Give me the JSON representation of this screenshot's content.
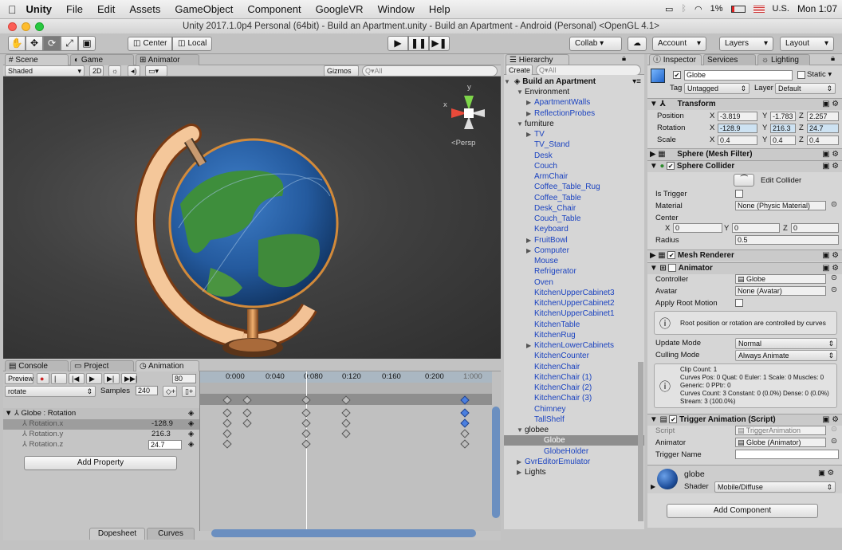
{
  "mac_menu": {
    "apple": "",
    "app": "Unity",
    "items": [
      "File",
      "Edit",
      "Assets",
      "GameObject",
      "Component",
      "GoogleVR",
      "Window",
      "Help"
    ],
    "battery": "1%",
    "region": "U.S.",
    "clock": "Mon 1:07"
  },
  "window_title": "Unity 2017.1.0p4 Personal (64bit) - Build an Apartment.unity - Build an Apartment - Android (Personal) <OpenGL 4.1>",
  "toolbar": {
    "center": "Center",
    "local": "Local",
    "collab": "Collab ▾",
    "account": "Account",
    "layers": "Layers",
    "layout": "Layout"
  },
  "scene_tabs": {
    "scene": "Scene",
    "game": "Game",
    "animator": "Animator"
  },
  "scene_bar": {
    "shaded": "Shaded",
    "two_d": "2D",
    "gizmos": "Gizmos",
    "search": "Q▾All"
  },
  "scene_view": {
    "persp": "Persp",
    "axes": {
      "y": "y",
      "x": "x"
    }
  },
  "hierarchy": {
    "tab": "Hierarchy",
    "create": "Create",
    "search": "Q▾All",
    "scene": "Build an Apartment",
    "rows": [
      {
        "t": "Environment",
        "i": 1,
        "a": "▼",
        "c": "n"
      },
      {
        "t": "ApartmentWalls",
        "i": 2,
        "a": "▶",
        "c": "b"
      },
      {
        "t": "ReflectionProbes",
        "i": 2,
        "a": "▶",
        "c": "b"
      },
      {
        "t": "furniture",
        "i": 1,
        "a": "▼",
        "c": "n"
      },
      {
        "t": "TV",
        "i": 2,
        "a": "▶",
        "c": "b"
      },
      {
        "t": "TV_Stand",
        "i": 2,
        "a": "",
        "c": "b"
      },
      {
        "t": "Desk",
        "i": 2,
        "a": "",
        "c": "b"
      },
      {
        "t": "Couch",
        "i": 2,
        "a": "",
        "c": "b"
      },
      {
        "t": "ArmChair",
        "i": 2,
        "a": "",
        "c": "b"
      },
      {
        "t": "Coffee_Table_Rug",
        "i": 2,
        "a": "",
        "c": "b"
      },
      {
        "t": "Coffee_Table",
        "i": 2,
        "a": "",
        "c": "b"
      },
      {
        "t": "Desk_Chair",
        "i": 2,
        "a": "",
        "c": "b"
      },
      {
        "t": "Couch_Table",
        "i": 2,
        "a": "",
        "c": "b"
      },
      {
        "t": "Keyboard",
        "i": 2,
        "a": "",
        "c": "b"
      },
      {
        "t": "FruitBowl",
        "i": 2,
        "a": "▶",
        "c": "b"
      },
      {
        "t": "Computer",
        "i": 2,
        "a": "▶",
        "c": "b"
      },
      {
        "t": "Mouse",
        "i": 2,
        "a": "",
        "c": "b"
      },
      {
        "t": "Refrigerator",
        "i": 2,
        "a": "",
        "c": "b"
      },
      {
        "t": "Oven",
        "i": 2,
        "a": "",
        "c": "b"
      },
      {
        "t": "KitchenUpperCabinet3",
        "i": 2,
        "a": "",
        "c": "b"
      },
      {
        "t": "KitchenUpperCabinet2",
        "i": 2,
        "a": "",
        "c": "b"
      },
      {
        "t": "KitchenUpperCabinet1",
        "i": 2,
        "a": "",
        "c": "b"
      },
      {
        "t": "KitchenTable",
        "i": 2,
        "a": "",
        "c": "b"
      },
      {
        "t": "KitchenRug",
        "i": 2,
        "a": "",
        "c": "b"
      },
      {
        "t": "KitchenLowerCabinets",
        "i": 2,
        "a": "▶",
        "c": "b"
      },
      {
        "t": "KitchenCounter",
        "i": 2,
        "a": "",
        "c": "b"
      },
      {
        "t": "KitchenChair",
        "i": 2,
        "a": "",
        "c": "b"
      },
      {
        "t": "KitchenChair (1)",
        "i": 2,
        "a": "",
        "c": "b"
      },
      {
        "t": "KitchenChair (2)",
        "i": 2,
        "a": "",
        "c": "b"
      },
      {
        "t": "KitchenChair (3)",
        "i": 2,
        "a": "",
        "c": "b"
      },
      {
        "t": "Chimney",
        "i": 2,
        "a": "",
        "c": "b"
      },
      {
        "t": "TallShelf",
        "i": 2,
        "a": "",
        "c": "b"
      },
      {
        "t": "globee",
        "i": 1,
        "a": "▼",
        "c": "n"
      },
      {
        "t": "Globe",
        "i": 3,
        "a": "",
        "c": "s"
      },
      {
        "t": "GlobeHolder",
        "i": 3,
        "a": "",
        "c": "b"
      },
      {
        "t": "GvrEditorEmulator",
        "i": 1,
        "a": "▶",
        "c": "b"
      },
      {
        "t": "Lights",
        "i": 1,
        "a": "▶",
        "c": "n"
      }
    ]
  },
  "inspector": {
    "tabs": {
      "inspector": "Inspector",
      "services": "Services",
      "lighting": "Lighting"
    },
    "name": "Globe",
    "static": "Static",
    "tag_label": "Tag",
    "tag": "Untagged",
    "layer_label": "Layer",
    "layer": "Default",
    "transform": {
      "title": "Transform",
      "position_label": "Position",
      "rotation_label": "Rotation",
      "scale_label": "Scale",
      "px": "-3.819",
      "py": "-1.783",
      "pz": "2.257",
      "rx": "-128.9",
      "ry": "216.3",
      "rz": "24.7",
      "sx": "0.4",
      "sy": "0.4",
      "sz": "0.4",
      "x": "X",
      "y": "Y",
      "z": "Z"
    },
    "mesh_filter": "Sphere (Mesh Filter)",
    "collider": {
      "title": "Sphere Collider",
      "edit": "Edit Collider",
      "is_trigger": "Is Trigger",
      "material_label": "Material",
      "material": "None (Physic Material)",
      "center_label": "Center",
      "cx": "0",
      "cy": "0",
      "cz": "0",
      "radius_label": "Radius",
      "radius": "0.5"
    },
    "mesh_renderer": "Mesh Renderer",
    "animator": {
      "title": "Animator",
      "controller_label": "Controller",
      "controller": "Globe",
      "avatar_label": "Avatar",
      "avatar": "None (Avatar)",
      "root_motion": "Apply Root Motion",
      "info": "Root position or rotation are controlled by curves",
      "update_label": "Update Mode",
      "update": "Normal",
      "culling_label": "Culling Mode",
      "culling": "Always Animate",
      "clip_info": [
        "Clip Count: 1",
        "Curves Pos: 0 Quat: 0 Euler: 1 Scale: 0 Muscles: 0",
        "Generic: 0 PPtr: 0",
        "Curves Count: 3 Constant: 0 (0.0%) Dense: 0 (0.0%)",
        "Stream: 3 (100.0%)"
      ]
    },
    "trigger": {
      "title": "Trigger Animation (Script)",
      "script_label": "Script",
      "script": "TriggerAnimation",
      "animator_label": "Animator",
      "animator": "Globe (Animator)",
      "name_label": "Trigger Name"
    },
    "material": {
      "name": "globe",
      "shader_label": "Shader",
      "shader": "Mobile/Diffuse"
    },
    "add_component": "Add Component"
  },
  "bottom_tabs": {
    "console": "Console",
    "project": "Project",
    "animation": "Animation"
  },
  "animation": {
    "preview": "Preview",
    "frame": "80",
    "clip": "rotate",
    "samples_label": "Samples",
    "samples": "240",
    "group": "Globe : Rotation",
    "props": [
      {
        "n": "Rotation.x",
        "v": "-128.9"
      },
      {
        "n": "Rotation.y",
        "v": "216.3"
      },
      {
        "n": "Rotation.z",
        "v": "24.7"
      }
    ],
    "add_property": "Add Property",
    "dopesheet": "Dopesheet",
    "curves": "Curves",
    "ruler": [
      "0:000",
      "0:040",
      "0:080",
      "0:120",
      "0:160",
      "0:200",
      "1:000"
    ]
  }
}
